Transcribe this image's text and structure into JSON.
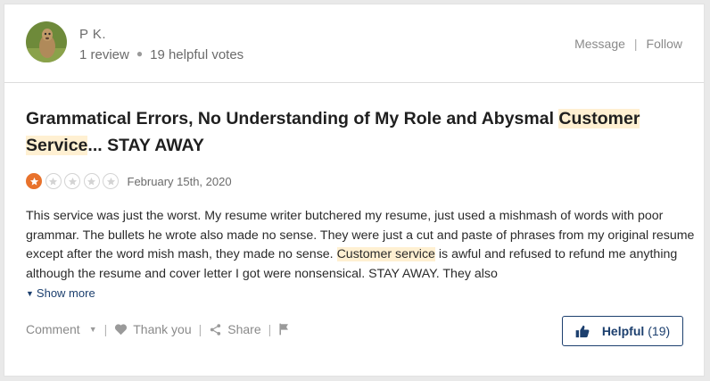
{
  "user": {
    "name": "P K.",
    "reviews": "1 review",
    "helpful_votes": "19 helpful votes",
    "avatar_icon": "avatar-photo"
  },
  "profile_actions": {
    "message": "Message",
    "separator": "|",
    "follow": "Follow"
  },
  "review": {
    "title_part1": "Grammatical Errors, No Understanding of My Role and Abysmal ",
    "title_highlight": "Customer Service",
    "title_part2": "... STAY AWAY",
    "rating": 1,
    "rating_max": 5,
    "date": "February 15th, 2020",
    "body_part1": "This service was just the worst. My resume writer butchered my resume, just used a mishmash of words with poor grammar. The bullets he wrote also made no sense. They were just a cut and paste of phrases from my original resume except after the word mish mash, they made no sense. ",
    "body_highlight": "Customer service",
    "body_part2": " is awful and refused to refund me anything although the resume and cover letter I got were nonsensical. STAY AWAY. They also",
    "show_more": "Show more"
  },
  "actions": {
    "comment": "Comment",
    "thank_you": "Thank you",
    "share": "Share",
    "divider": "|",
    "helpful_label": "Helpful",
    "helpful_count": "(19)"
  },
  "colors": {
    "star_filled": "#e8722c",
    "highlight": "#fff0d2",
    "brand_navy": "#1c3f6e"
  }
}
